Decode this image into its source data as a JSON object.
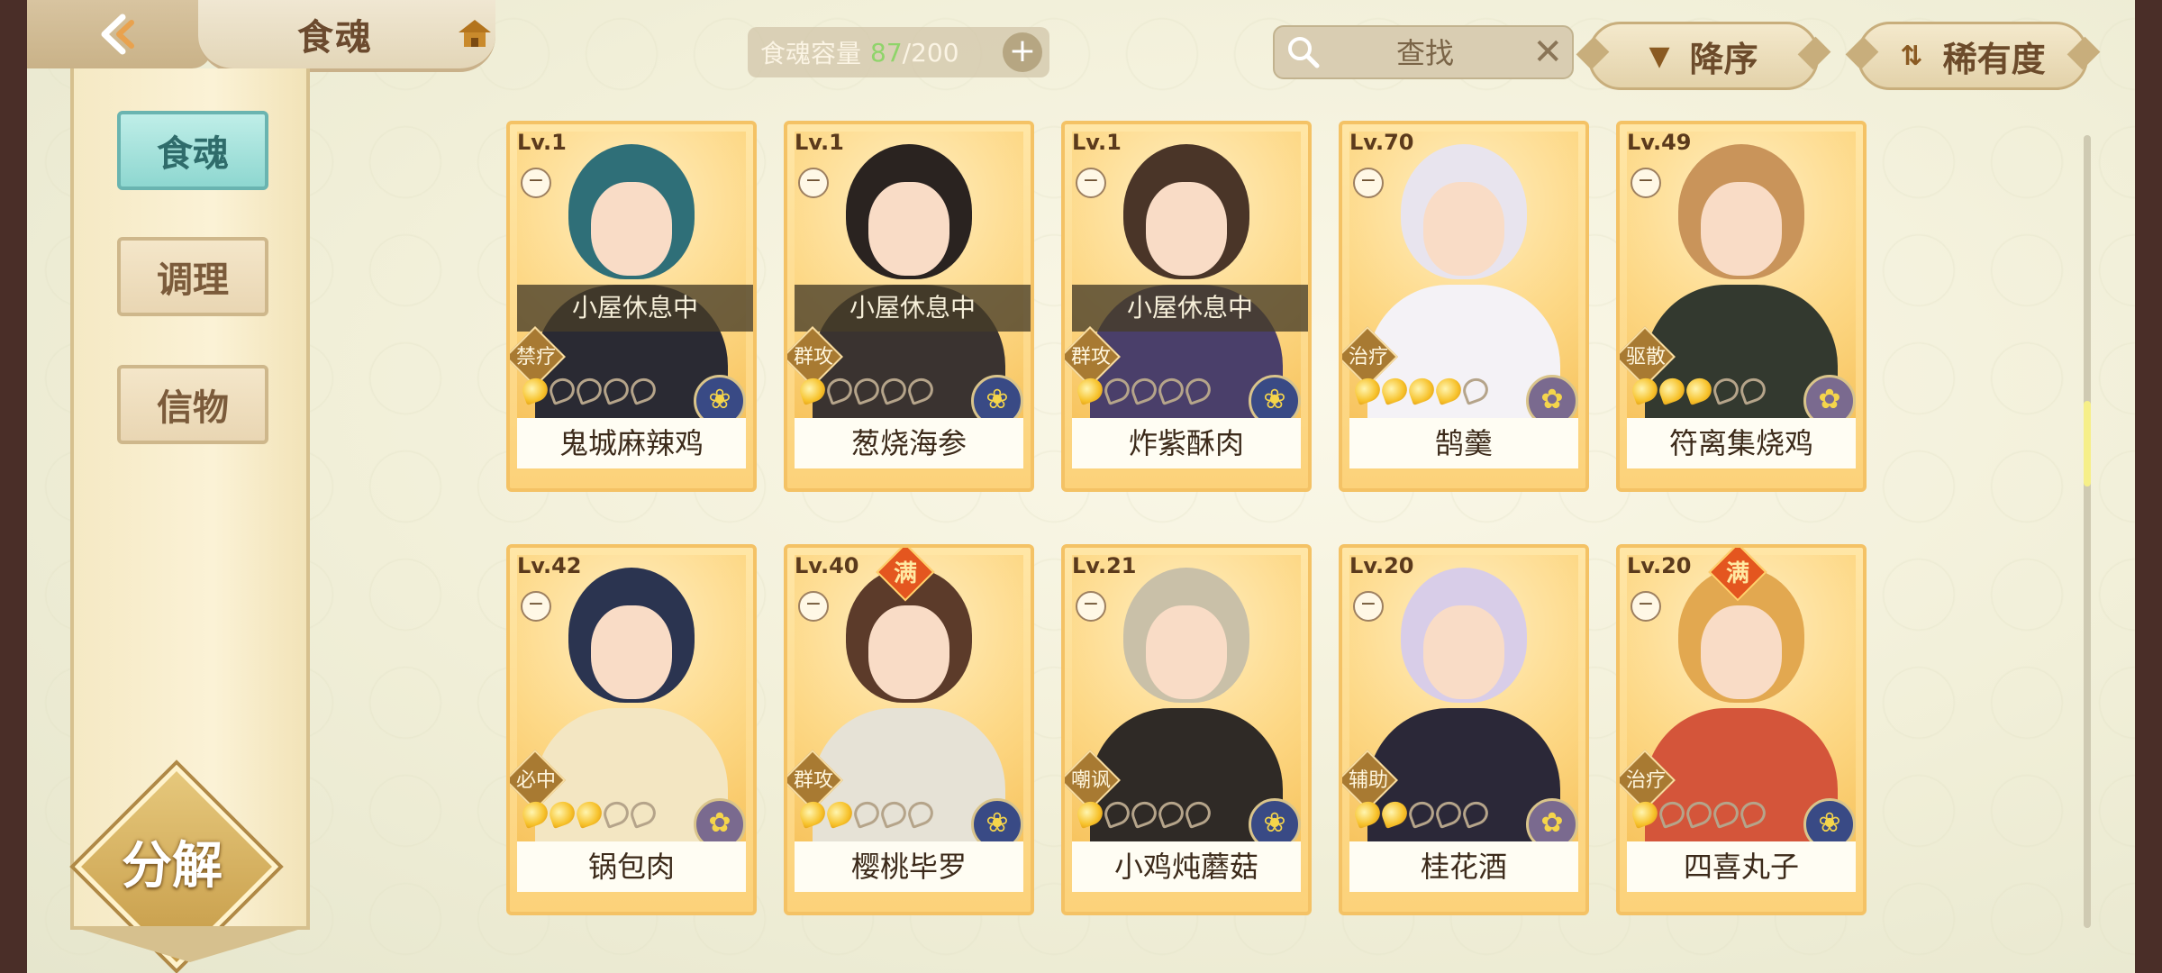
{
  "header": {
    "title": "食魂",
    "capacity_label": "食魂容量",
    "capacity_current": "87",
    "capacity_max": "/200",
    "capacity_add": "+",
    "search_placeholder": "查找",
    "search_clear": "✕",
    "sort_label": "降序",
    "sort_icon": "▼",
    "filter_label": "稀有度",
    "filter_icon": "⇅"
  },
  "sidebar": {
    "tabs": [
      {
        "label": "食魂",
        "active": true
      },
      {
        "label": "调理",
        "active": false
      },
      {
        "label": "信物",
        "active": false
      }
    ],
    "decompose_label": "分解"
  },
  "cards": [
    {
      "level": "Lv.1",
      "name": "鬼城麻辣鸡",
      "role": "禁疗",
      "status": "小屋休息中",
      "rank": 1,
      "element": "water",
      "full": false,
      "hair": "#2f6f78",
      "body": "#2a2a33"
    },
    {
      "level": "Lv.1",
      "name": "葱烧海参",
      "role": "群攻",
      "status": "小屋休息中",
      "rank": 1,
      "element": "water",
      "full": false,
      "hair": "#2a2320",
      "body": "#3a3330"
    },
    {
      "level": "Lv.1",
      "name": "炸紫酥肉",
      "role": "群攻",
      "status": "小屋休息中",
      "rank": 1,
      "element": "water",
      "full": false,
      "hair": "#4a3528",
      "body": "#4a3f6a"
    },
    {
      "level": "Lv.70",
      "name": "鹄羹",
      "role": "治疗",
      "status": "",
      "rank": 4,
      "element": "gold",
      "full": false,
      "hair": "#e8e4ee",
      "body": "#f4f2f6"
    },
    {
      "level": "Lv.49",
      "name": "符离集烧鸡",
      "role": "驱散",
      "status": "",
      "rank": 3,
      "element": "gold",
      "full": false,
      "hair": "#c9945a",
      "body": "#33392f"
    },
    {
      "level": "Lv.42",
      "name": "锅包肉",
      "role": "必中",
      "status": "",
      "rank": 3,
      "element": "gold",
      "full": false,
      "hair": "#2b3450",
      "body": "#f3e6c2"
    },
    {
      "level": "Lv.40",
      "name": "樱桃毕罗",
      "role": "群攻",
      "status": "",
      "rank": 2,
      "element": "water",
      "full": true,
      "hair": "#5c3b2a",
      "body": "#e6e2d6"
    },
    {
      "level": "Lv.21",
      "name": "小鸡炖蘑菇",
      "role": "嘲讽",
      "status": "",
      "rank": 1,
      "element": "water",
      "full": false,
      "hair": "#c9c0a8",
      "body": "#2f2a26"
    },
    {
      "level": "Lv.20",
      "name": "桂花酒",
      "role": "辅助",
      "status": "",
      "rank": 2,
      "element": "gold",
      "full": false,
      "hair": "#d8cde8",
      "body": "#2b2838"
    },
    {
      "level": "Lv.20",
      "name": "四喜丸子",
      "role": "治疗",
      "status": "",
      "rank": 1,
      "element": "water",
      "full": true,
      "hair": "#e2a850",
      "body": "#d4553a"
    }
  ],
  "full_badge": "满",
  "lock_glyph": "−",
  "element_glyphs": {
    "water": "❀",
    "gold": "✿"
  }
}
